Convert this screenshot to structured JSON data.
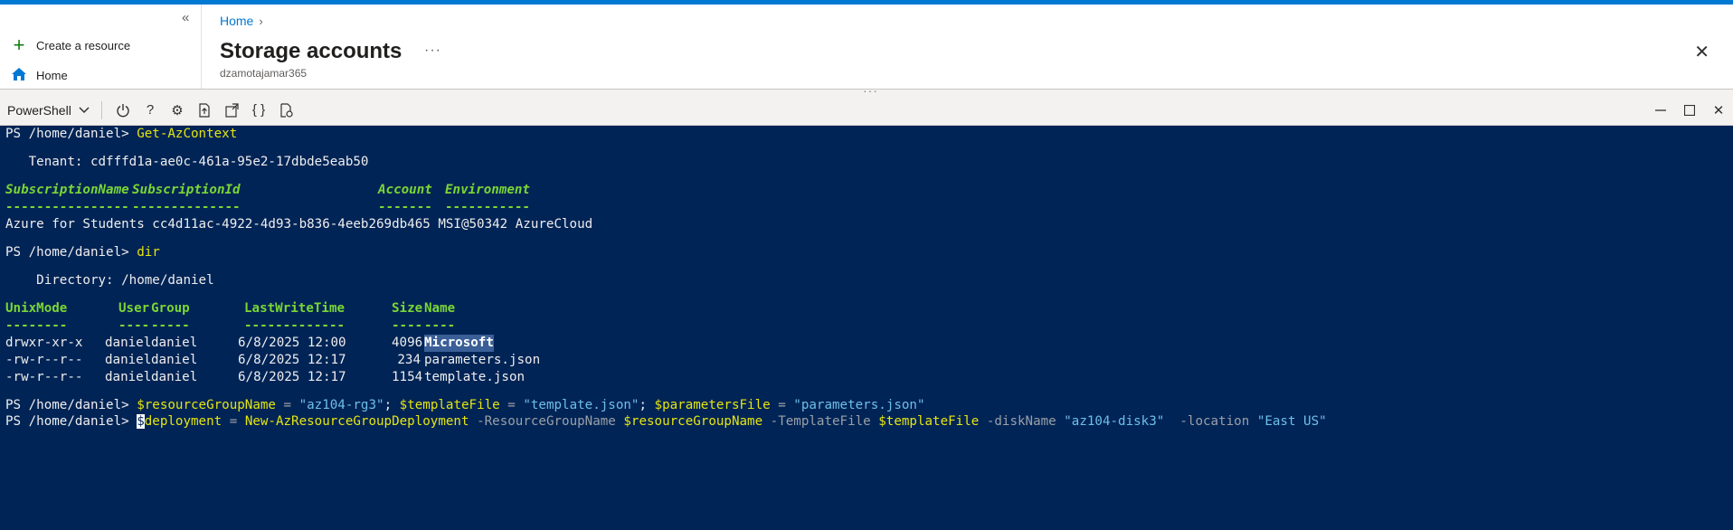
{
  "nav": {
    "collapse_glyph": "«",
    "create_label": "Create a resource",
    "home_label": "Home"
  },
  "blade": {
    "breadcrumb_home": "Home",
    "title": "Storage accounts",
    "more": "···",
    "subtitle": "dzamotajamar365"
  },
  "shell": {
    "selected": "PowerShell"
  },
  "terminal": {
    "prompt": "PS /home/daniel> ",
    "cmd1": "Get-AzContext",
    "tenant_line": "   Tenant: cdfffd1a-ae0c-461a-95e2-17dbde5eab50",
    "ctx_headers": {
      "c1": "SubscriptionName",
      "c2": "SubscriptionId",
      "c3": "Account",
      "c4": "Environment"
    },
    "ctx_dashes": {
      "c1": "----------------",
      "c2": "--------------",
      "c3": "-------",
      "c4": "-----------"
    },
    "ctx_row": "Azure for Students cc4d11ac-4922-4d93-b836-4eeb269db465 MSI@50342 AzureCloud",
    "cmd2": "dir",
    "directory_line": "    Directory: /home/daniel",
    "dir_headers": {
      "c1": "UnixMode",
      "c2": "User",
      "c3": "Group",
      "c4": "LastWriteTime",
      "c5": "Size",
      "c6": "Name"
    },
    "dir_dashes": {
      "c1": "--------",
      "c2": "----",
      "c3": "-----",
      "c4": "-------------",
      "c5": "----",
      "c6": "----"
    },
    "dir_rows": [
      {
        "mode": "drwxr-xr-x",
        "user": "daniel",
        "group": "daniel",
        "time": "6/8/2025 12:00",
        "size": "4096",
        "name": "Microsoft"
      },
      {
        "mode": "-rw-r--r--",
        "user": "daniel",
        "group": "daniel",
        "time": "6/8/2025 12:17",
        "size": "234",
        "name": "parameters.json"
      },
      {
        "mode": "-rw-r--r--",
        "user": "daniel",
        "group": "daniel",
        "time": "6/8/2025 12:17",
        "size": "1154",
        "name": "template.json"
      }
    ],
    "cmd3": {
      "v1": "$resourceGroupName",
      "eq1": " = ",
      "s1": "\"az104-rg3\"",
      "semi1": "; ",
      "v2": "$templateFile",
      "eq2": " = ",
      "s2": "\"template.json\"",
      "semi2": "; ",
      "v3": "$parametersFile",
      "eq3": " = ",
      "s3": "\"parameters.json\""
    },
    "cmd4": {
      "cursor_char": "$",
      "v1": "deployment",
      "eq": " = ",
      "cmdlet": "New-AzResourceGroupDeployment",
      "p1": " -ResourceGroupName ",
      "v2": "$resourceGroupName",
      "p2": " -TemplateFile ",
      "v3": "$templateFile",
      "p3": " -diskName ",
      "s1": "\"az104-disk3\"",
      "p4": "  -location ",
      "s2": "\"East US\""
    }
  }
}
